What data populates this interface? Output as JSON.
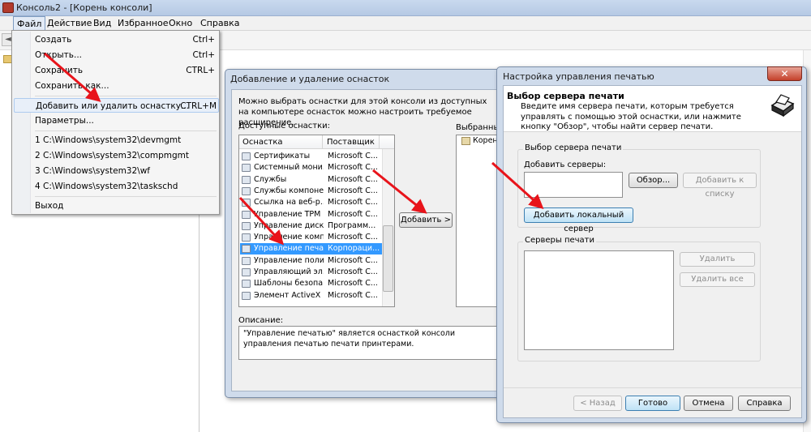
{
  "window": {
    "title": "Консоль2 - [Корень консоли]"
  },
  "menubar": {
    "items": [
      "Файл",
      "Действие",
      "Вид",
      "Избранное",
      "Окно",
      "Справка"
    ]
  },
  "file_menu": {
    "items": [
      {
        "label": "Создать",
        "shortcut": "Ctrl+"
      },
      {
        "label": "Открыть...",
        "shortcut": "Ctrl+"
      },
      {
        "label": "Сохранить",
        "shortcut": "CTRL+"
      },
      {
        "label": "Сохранить как...",
        "shortcut": ""
      },
      {
        "label": "Добавить или удалить оснастку...",
        "shortcut": "CTRL+M"
      },
      {
        "label": "Параметры...",
        "shortcut": ""
      },
      {
        "label": "1 C:\\Windows\\system32\\devmgmt",
        "shortcut": ""
      },
      {
        "label": "2 C:\\Windows\\system32\\compmgmt",
        "shortcut": ""
      },
      {
        "label": "3 C:\\Windows\\system32\\wf",
        "shortcut": ""
      },
      {
        "label": "4 C:\\Windows\\system32\\taskschd",
        "shortcut": ""
      },
      {
        "label": "Выход",
        "shortcut": ""
      }
    ]
  },
  "snapin_dialog": {
    "title": "Добавление и удаление оснасток",
    "intro": "Можно выбрать оснастки для этой консоли из доступных на компьютере оснасток можно настроить требуемое расширение.",
    "available_label": "Доступные оснастки:",
    "columns": [
      "Оснастка",
      "Поставщик"
    ],
    "rows": [
      {
        "name": "Сертификаты",
        "vendor": "Microsoft C..."
      },
      {
        "name": "Системный мони...",
        "vendor": "Microsoft C..."
      },
      {
        "name": "Службы",
        "vendor": "Microsoft C..."
      },
      {
        "name": "Службы компоне...",
        "vendor": "Microsoft C..."
      },
      {
        "name": "Ссылка на веб-р...",
        "vendor": "Microsoft C..."
      },
      {
        "name": "Управление TPM",
        "vendor": "Microsoft C..."
      },
      {
        "name": "Управление диск...",
        "vendor": "Программ..."
      },
      {
        "name": "Управление комп...",
        "vendor": "Microsoft C..."
      },
      {
        "name": "Управление печа...",
        "vendor": "Корпораци..."
      },
      {
        "name": "Управление поли...",
        "vendor": "Microsoft C..."
      },
      {
        "name": "Управляющий эл...",
        "vendor": "Microsoft C..."
      },
      {
        "name": "Шаблоны безопа...",
        "vendor": "Microsoft C..."
      },
      {
        "name": "Элемент ActiveX",
        "vendor": "Microsoft C..."
      }
    ],
    "selected_row": 8,
    "add_button": "Добавить >",
    "selected_label": "Выбранные",
    "selected_item": "Корень",
    "description_label": "Описание:",
    "description": "\"Управление печатью\" является оснасткой консоли управления печатью печати принтерами."
  },
  "print_dialog": {
    "title": "Настройка управления печатью",
    "header_title": "Выбор сервера печати",
    "header_desc": "Введите имя сервера печати, которым требуется управлять с помощью этой оснастки, или нажмите кнопку \"Обзор\", чтобы найти сервер печати.",
    "group1_title": "Выбор сервера печати",
    "add_servers_label": "Добавить серверы:",
    "server_input_value": "",
    "browse_button": "Обзор...",
    "add_to_list_button": "Добавить к списку",
    "add_local_button": "Добавить локальный сервер",
    "group2_title": "Серверы печати",
    "remove_button": "Удалить",
    "remove_all_button": "Удалить все",
    "back_button": "< Назад",
    "done_button": "Готово",
    "cancel_button": "Отмена",
    "help_button": "Справка",
    "close_icon": "close-icon"
  },
  "colors": {
    "annotation_arrow": "#e8141b",
    "selection": "#3399ff"
  }
}
